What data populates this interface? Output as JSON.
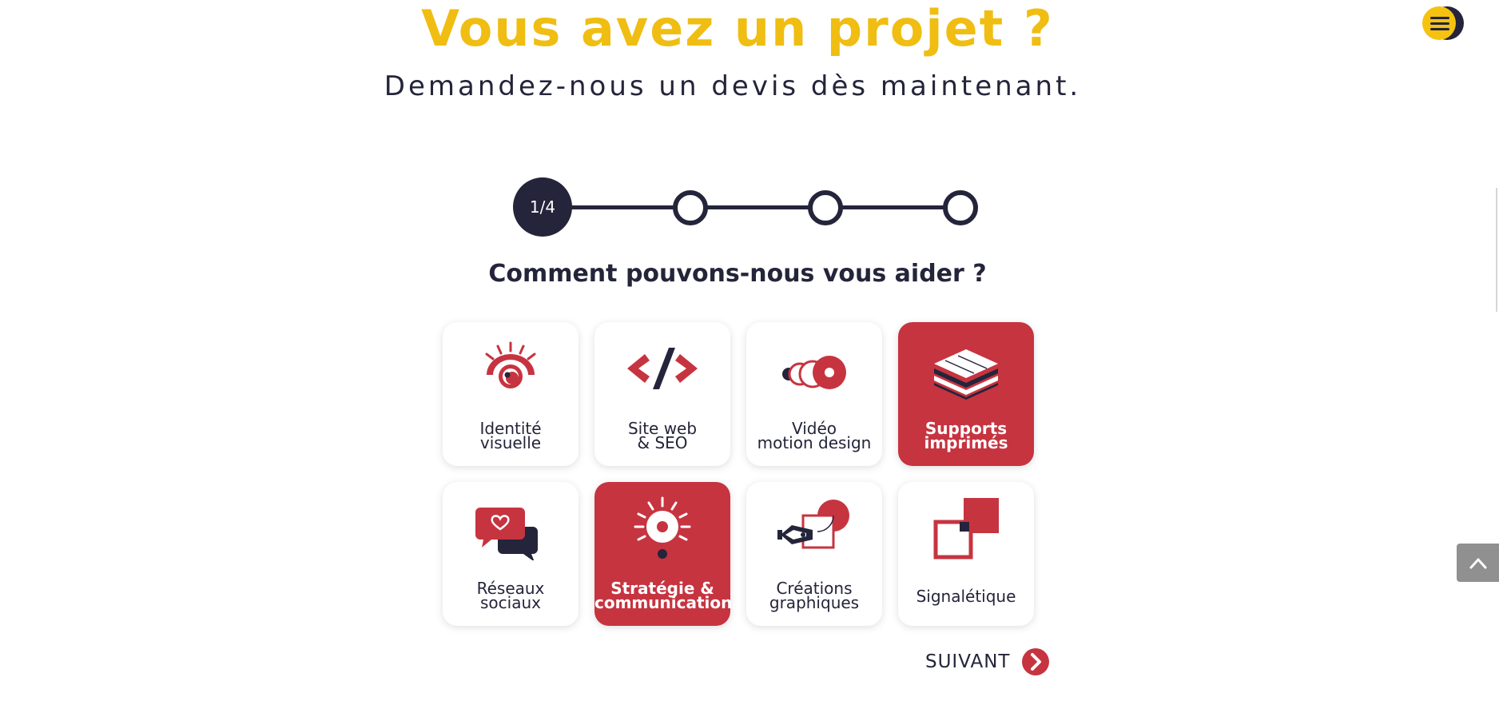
{
  "hero": {
    "title": "Vous avez un projet ?",
    "subtitle": "Demandez-nous un devis dès maintenant."
  },
  "stepper": {
    "current_label": "1/4",
    "current_step": 1,
    "total_steps": 4
  },
  "question": "Comment pouvons-nous vous aider ?",
  "services": [
    {
      "label": "Identité\nvisuelle",
      "icon": "eye-icon",
      "selected": false
    },
    {
      "label": "Site web\n& SEO",
      "icon": "code-icon",
      "selected": false
    },
    {
      "label": "Vidéo\nmotion design",
      "icon": "video-reel-icon",
      "selected": false
    },
    {
      "label": "Supports\nimprimés",
      "icon": "printed-stack-icon",
      "selected": true
    },
    {
      "label": "Réseaux\nsociaux",
      "icon": "chat-heart-icon",
      "selected": false
    },
    {
      "label": "Stratégie &\ncommunication",
      "icon": "lightbulb-icon",
      "selected": true
    },
    {
      "label": "Créations\ngraphiques",
      "icon": "pen-nib-icon",
      "selected": false
    },
    {
      "label": "Signalétique",
      "icon": "signage-squares-icon",
      "selected": false
    }
  ],
  "next_label": "SUIVANT",
  "colors": {
    "accent_yellow": "#f0bd12",
    "accent_red": "#c63440",
    "navy": "#24243a"
  }
}
